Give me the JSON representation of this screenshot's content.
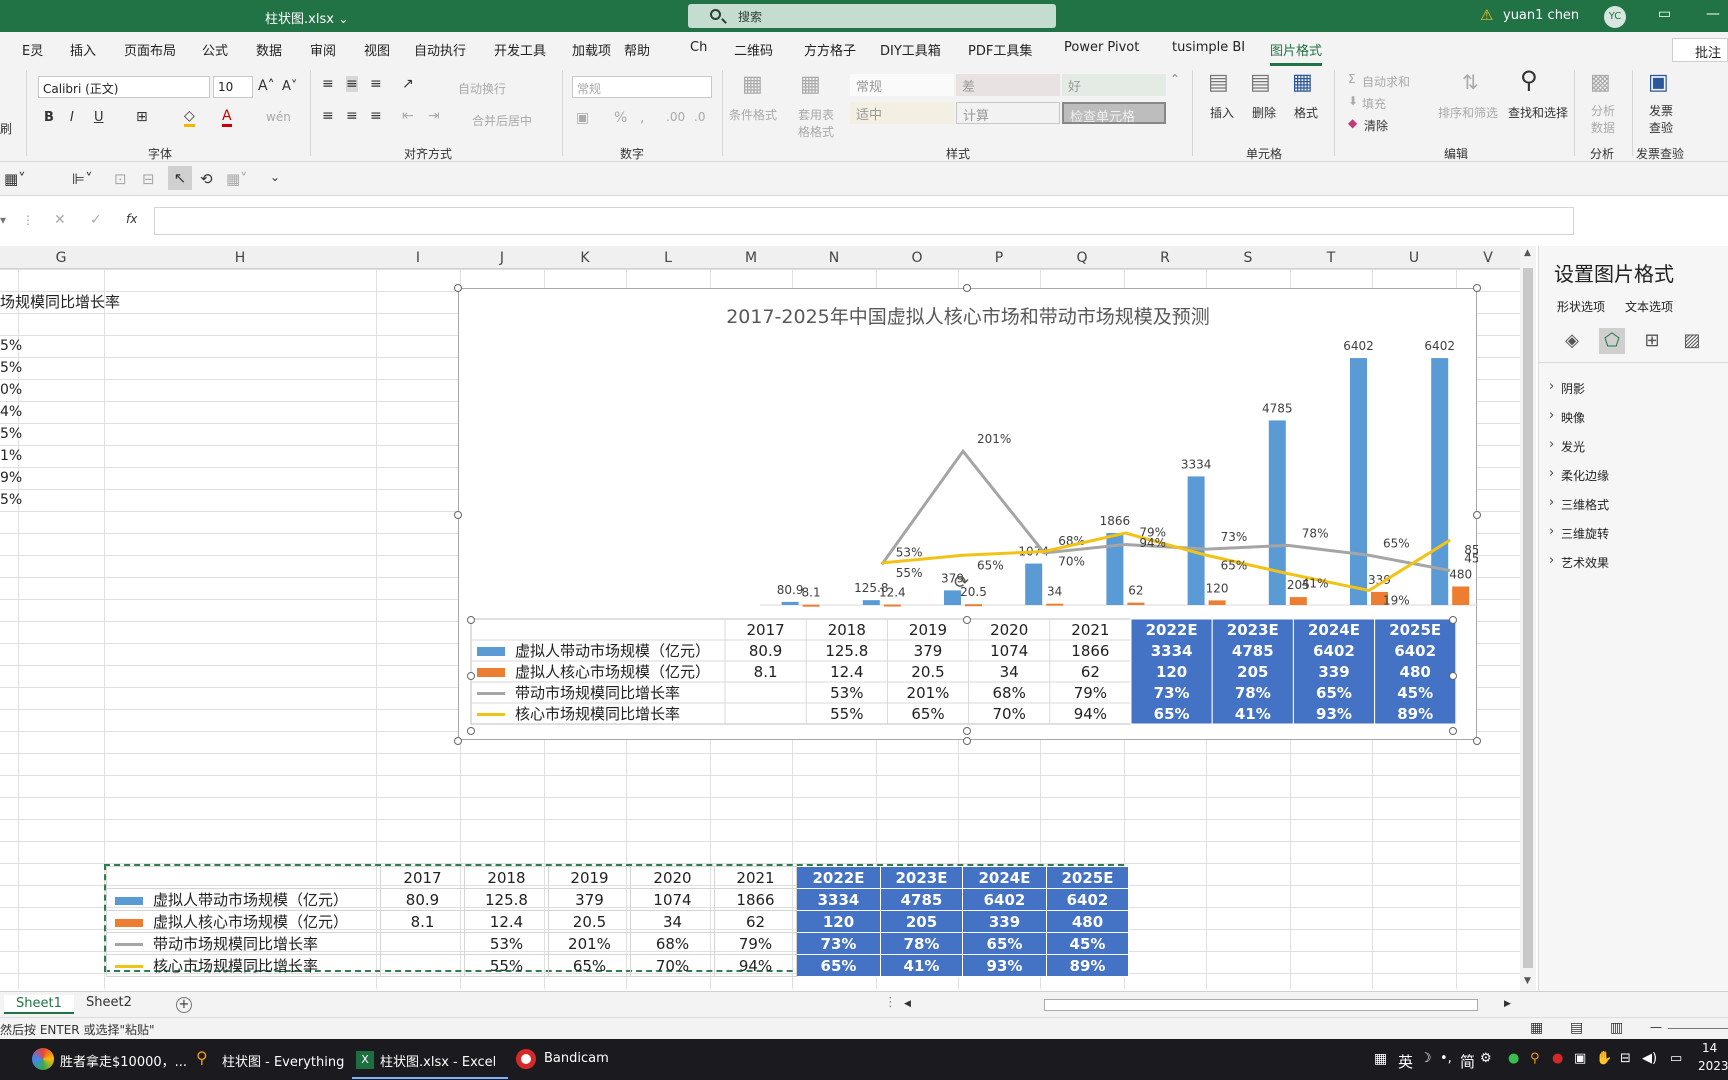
{
  "title_bar": {
    "file": "柱状图.xlsx ⌄",
    "search": "搜索",
    "user": "yuan1 chen",
    "avatar": "YC"
  },
  "ribbon_tabs": [
    "E灵",
    "插入",
    "页面布局",
    "公式",
    "数据",
    "审阅",
    "视图",
    "自动执行",
    "开发工具",
    "加载项",
    "帮助",
    "Ch",
    "二维码",
    "方方格子",
    "DIY工具箱",
    "PDF工具集",
    "Power Pivot",
    "tusimple BI",
    "图片格式"
  ],
  "ribbon": {
    "comment": "批注",
    "font_name": "Calibri (正文)",
    "font_size": "10",
    "number_format": "常规",
    "wrap": "自动换行",
    "merge": "合并后居中",
    "cond_format": "条件格式",
    "table_format": "套用表格格式",
    "styles": [
      "常规",
      "差",
      "好",
      "适中",
      "计算",
      "检查单元格"
    ],
    "insert": "插入",
    "delete": "删除",
    "format": "格式",
    "autosum": "自动求和",
    "fill": "填充",
    "clear": "清除",
    "sort": "排序和筛选",
    "find": "查找和选择",
    "analyze": "分析数据",
    "invoice": "发票查验",
    "groups": {
      "font": "字体",
      "align": "对齐方式",
      "number": "数字",
      "styles": "样式",
      "cells": "单元格",
      "edit": "编辑",
      "analyze": "分析",
      "invoice": "发票查验"
    },
    "left_label": "刷"
  },
  "formula_bar": {
    "fx": "fx"
  },
  "columns": [
    "G",
    "H",
    "I",
    "J",
    "K",
    "L",
    "M",
    "N",
    "O",
    "P",
    "Q",
    "R",
    "S",
    "T",
    "U",
    "V"
  ],
  "sheet_cells": {
    "h_header": "场规模同比增长率",
    "pct_col": [
      "5%",
      "5%",
      "0%",
      "4%",
      "5%",
      "1%",
      "9%",
      "5%"
    ]
  },
  "chart_data": {
    "type": "bar",
    "title": "2017-2025年中国虚拟人核心市场和带动市场规模及预测",
    "categories": [
      "2017",
      "2018",
      "2019",
      "2020",
      "2021",
      "2022E",
      "2023E",
      "2024E",
      "2025E"
    ],
    "series": [
      {
        "name": "虚拟人带动市场规模（亿元）",
        "kind": "bar",
        "color": "#5b9bd5",
        "values": [
          80.9,
          125.8,
          379,
          1074,
          1866,
          3334,
          4785,
          6402,
          6402
        ],
        "labels": [
          "80.9",
          "125.8",
          "379",
          "1074",
          "1866",
          "3334",
          "4785",
          "6402",
          "6402"
        ]
      },
      {
        "name": "虚拟人核心市场规模（亿元）",
        "kind": "bar",
        "color": "#ed7d31",
        "values": [
          8.1,
          12.4,
          20.5,
          34,
          62,
          120,
          205,
          339,
          480
        ],
        "labels": [
          "8.1",
          "12.4",
          "20.5",
          "34",
          "62",
          "120",
          "205",
          "339",
          "480"
        ]
      },
      {
        "name": "带动市场规模同比增长率",
        "kind": "line",
        "color": "#a5a5a5",
        "values": [
          null,
          53,
          201,
          68,
          79,
          73,
          78,
          65,
          45
        ],
        "labels": [
          "",
          "53%",
          "201%",
          "68%",
          "79%",
          "73%",
          "78%",
          "65%",
          "45%"
        ]
      },
      {
        "name": "核心市场规模同比增长率",
        "kind": "line",
        "color": "#f2c314",
        "values": [
          null,
          55,
          65,
          70,
          94,
          65,
          41,
          19,
          85
        ],
        "labels": [
          "",
          "55%",
          "65%",
          "70%",
          "94%",
          "65%",
          "41%",
          "19%",
          "85%"
        ]
      }
    ],
    "table_rows": [
      [
        "80.9",
        "125.8",
        "379",
        "1074",
        "1866",
        "3334",
        "4785",
        "6402",
        "6402"
      ],
      [
        "8.1",
        "12.4",
        "20.5",
        "34",
        "62",
        "120",
        "205",
        "339",
        "480"
      ],
      [
        "",
        "53%",
        "201%",
        "68%",
        "79%",
        "73%",
        "78%",
        "65%",
        "45%"
      ],
      [
        "",
        "55%",
        "65%",
        "70%",
        "94%",
        "65%",
        "41%",
        "93%",
        "89%"
      ]
    ],
    "ylim": [
      0,
      7000
    ],
    "y2lim": [
      0,
      300
    ],
    "grid": false
  },
  "panel": {
    "title": "设置图片格式",
    "tabs": [
      "形状选项",
      "文本选项"
    ],
    "items": [
      "阴影",
      "映像",
      "发光",
      "柔化边缘",
      "三维格式",
      "三维旋转",
      "艺术效果"
    ]
  },
  "sheets": [
    "Sheet1",
    "Sheet2"
  ],
  "status": "然后按 ENTER 或选择\"粘贴\"",
  "taskbar": {
    "items": [
      "胜者拿走$10000，...",
      "柱状图 - Everything",
      "柱状图.xlsx - Excel",
      "Bandicam"
    ],
    "ime": "英",
    "ime2": "简",
    "time": "14",
    "date": "2023"
  }
}
